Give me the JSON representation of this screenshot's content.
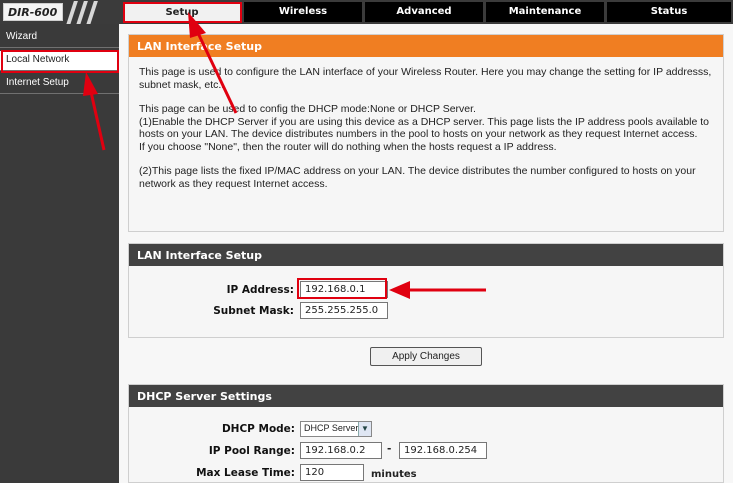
{
  "brand": {
    "logo_text": "DIR-600"
  },
  "tabs": [
    {
      "label": "Setup"
    },
    {
      "label": "Wireless"
    },
    {
      "label": "Advanced"
    },
    {
      "label": "Maintenance"
    },
    {
      "label": "Status"
    }
  ],
  "sidebar": {
    "items": [
      {
        "label": "Wizard"
      },
      {
        "label": "Local Network"
      },
      {
        "label": "Internet Setup"
      }
    ]
  },
  "intro": {
    "title": "LAN Interface Setup",
    "p1": "This page is used to configure the LAN interface of your Wireless Router. Here you may change the setting for IP addresss, subnet mask, etc..",
    "p2": "This page can be used to config the DHCP mode:None or DHCP Server.",
    "p3": "(1)Enable the DHCP Server if you are using this device as a DHCP server. This page lists the IP address pools available to hosts on your LAN. The device distributes numbers in the pool to hosts on your network as they request Internet access.",
    "p4": "If you choose \"None\", then the router will do nothing when the hosts request a IP address.",
    "p5": "(2)This page lists the fixed IP/MAC address on your LAN. The device distributes the number configured to hosts on your network as they request Internet access."
  },
  "lan": {
    "title": "LAN Interface Setup",
    "ip_label": "IP Address:",
    "ip_value": "192.168.0.1",
    "mask_label": "Subnet Mask:",
    "mask_value": "255.255.255.0",
    "apply_label": "Apply Changes"
  },
  "dhcp": {
    "title": "DHCP Server Settings",
    "mode_label": "DHCP Mode:",
    "mode_value": "DHCP Server",
    "pool_label": "IP Pool Range:",
    "pool_start": "192.168.0.2",
    "pool_dash": "-",
    "pool_end": "192.168.0.254",
    "lease_label": "Max Lease Time:",
    "lease_value": "120",
    "lease_unit": "minutes"
  },
  "colors": {
    "accent_orange": "#f07e22",
    "header_dark": "#424242",
    "annotation_red": "#e00010"
  }
}
